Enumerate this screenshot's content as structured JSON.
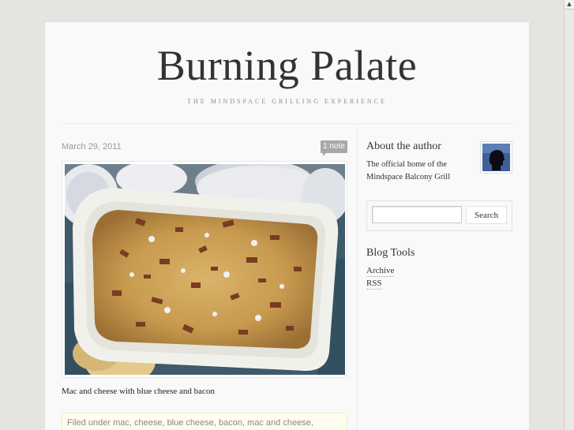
{
  "blog": {
    "title": "Burning Palate",
    "subtitle": "THE MINDSPACE GRILLING EXPERIENCE"
  },
  "post": {
    "date": "March 29, 2011",
    "notes": "1 note",
    "caption": "Mac and cheese with blue cheese and bacon",
    "tags": "Filed under mac, cheese, blue cheese, bacon, mac and cheese,"
  },
  "sidebar": {
    "about_title": "About the author",
    "about_text": "The official home of the Mindspace Balcony Grill",
    "search": {
      "value": "",
      "placeholder": "",
      "button_label": "Search"
    },
    "tools_title": "Blog Tools",
    "tools": [
      {
        "label": "Archive"
      },
      {
        "label": "RSS"
      }
    ]
  },
  "scrollbar": {
    "up_arrow": "▲"
  },
  "colors": {
    "page_bg": "#f9f9f9",
    "window_bg": "#e5e4e1",
    "badge": "#a8a8a8",
    "tags_bg": "#fffdef"
  }
}
